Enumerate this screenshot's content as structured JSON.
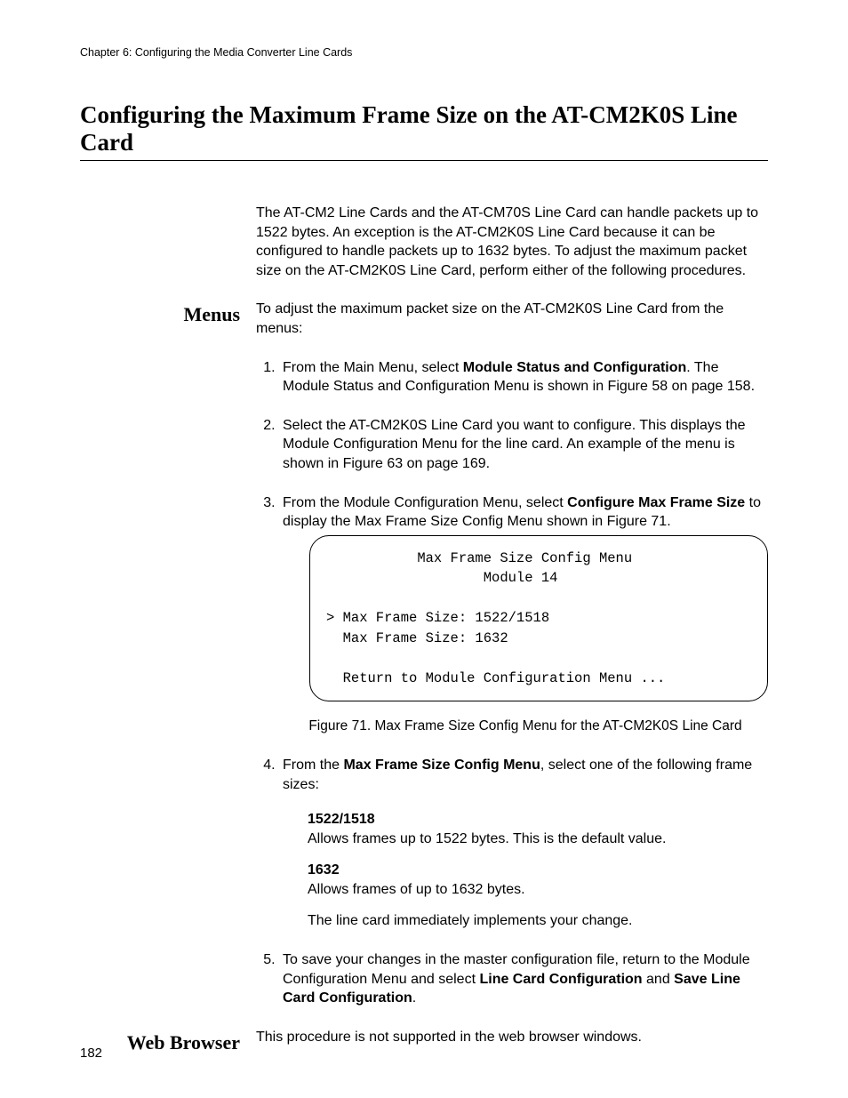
{
  "header": {
    "chapter": "Chapter 6: Configuring the Media Converter Line Cards"
  },
  "title": "Configuring the Maximum Frame Size on the AT-CM2K0S Line Card",
  "intro": "The AT-CM2 Line Cards and the AT-CM70S Line Card can handle packets up to 1522 bytes. An exception is the AT-CM2K0S Line Card because it can be configured to handle packets up to 1632 bytes. To adjust the maximum packet size on the AT-CM2K0S Line Card, perform either of the following procedures.",
  "sections": {
    "menus": {
      "label": "Menus",
      "intro": "To adjust the maximum packet size on the AT-CM2K0S Line Card from the menus:",
      "steps": {
        "s1_a": "From the Main Menu, select ",
        "s1_b": "Module Status and Configuration",
        "s1_c": ". The Module Status and Configuration Menu is shown in Figure 58 on page 158.",
        "s2": "Select the AT-CM2K0S Line Card you want to configure. This displays the Module Configuration Menu for the line card. An example of the menu is shown in Figure 63 on page 169.",
        "s3_a": "From the Module Configuration Menu, select ",
        "s3_b": "Configure Max Frame Size",
        "s3_c": " to display the Max Frame Size Config Menu shown in Figure 71.",
        "s4_a": "From the ",
        "s4_b": "Max Frame Size Config Menu",
        "s4_c": ", select one of the following frame sizes:",
        "s5_a": "To save your changes in the master configuration file, return to the Module Configuration Menu and select ",
        "s5_b": "Line Card Configuration",
        "s5_c": " and ",
        "s5_d": "Save Line Card Configuration",
        "s5_e": "."
      },
      "config_box": "           Max Frame Size Config Menu\n                   Module 14\n\n> Max Frame Size: 1522/1518\n  Max Frame Size: 1632\n\n  Return to Module Configuration Menu ...",
      "figure_caption": "Figure 71. Max Frame Size Config Menu for the AT-CM2K0S Line Card",
      "options": {
        "o1_term": "1522/1518",
        "o1_desc": "Allows frames up to 1522 bytes. This is the default value.",
        "o2_term": "1632",
        "o2_desc": "Allows frames of up to 1632 bytes."
      },
      "note": "The line card immediately implements your change."
    },
    "web": {
      "label": "Web Browser",
      "text": "This procedure is not supported in the web browser windows."
    }
  },
  "page_number": "182"
}
